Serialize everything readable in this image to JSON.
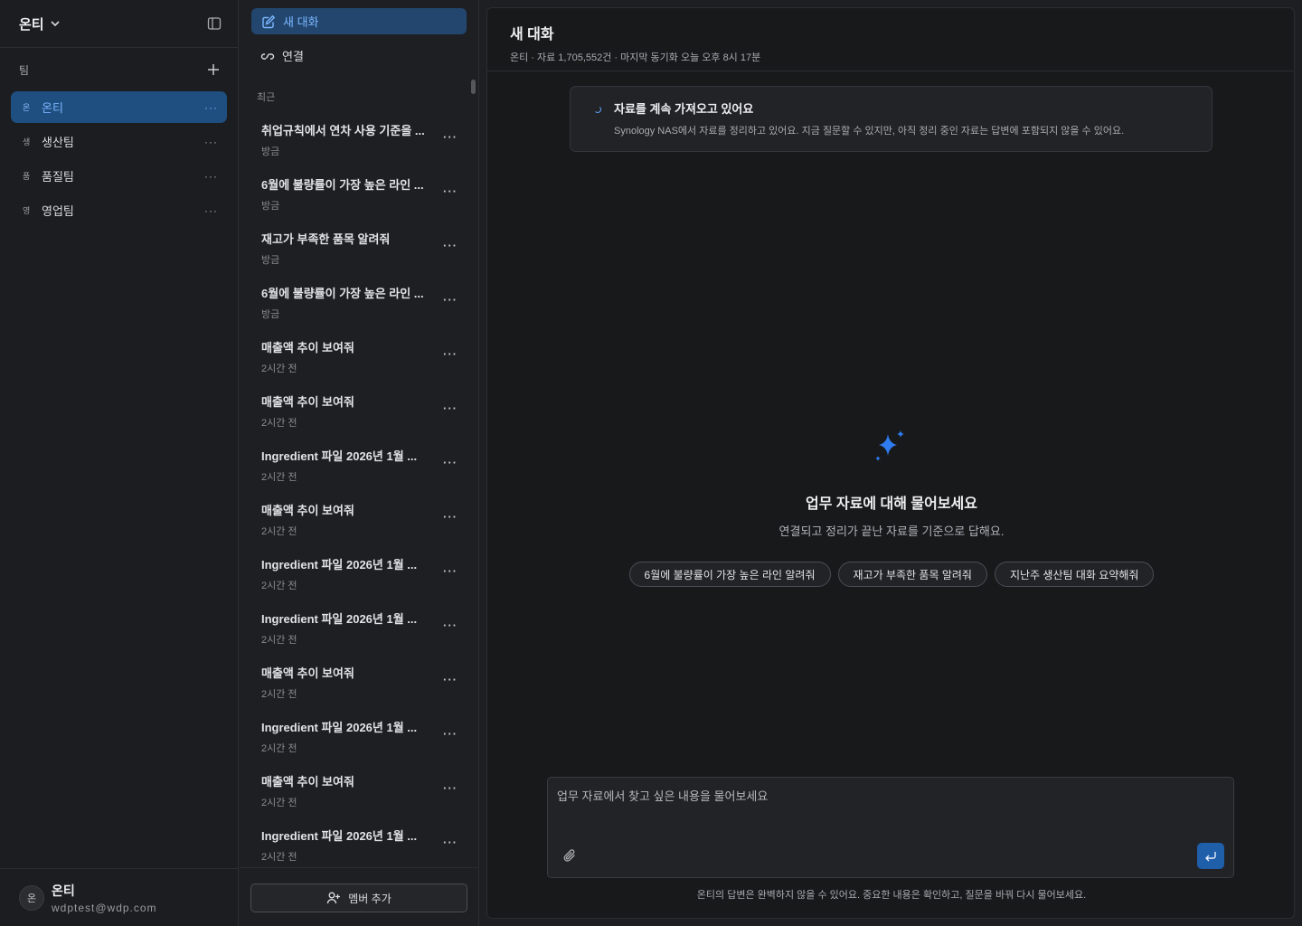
{
  "workspace": {
    "name": "온티"
  },
  "teams": {
    "label": "팀",
    "items": [
      {
        "abbr": "온",
        "name": "온티",
        "active": true
      },
      {
        "abbr": "생",
        "name": "생산팀",
        "active": false
      },
      {
        "abbr": "품",
        "name": "품질팀",
        "active": false
      },
      {
        "abbr": "영",
        "name": "영업팀",
        "active": false
      }
    ],
    "more": "···"
  },
  "user": {
    "avatar": "온",
    "name": "온티",
    "email": "wdptest@wdp.com"
  },
  "nav": {
    "new_chat": "새 대화",
    "connect": "연결",
    "recent": "최근"
  },
  "conversations": [
    {
      "title": "취업규칙에서 연차 사용 기준을 ...",
      "time": "방금"
    },
    {
      "title": "6월에 불량률이 가장 높은 라인 ...",
      "time": "방금"
    },
    {
      "title": "재고가 부족한 품목 알려줘",
      "time": "방금"
    },
    {
      "title": "6월에 불량률이 가장 높은 라인 ...",
      "time": "방금"
    },
    {
      "title": "매출액 추이 보여줘",
      "time": "2시간 전"
    },
    {
      "title": "매출액 추이 보여줘",
      "time": "2시간 전"
    },
    {
      "title": "Ingredient 파일 2026년 1월 ...",
      "time": "2시간 전"
    },
    {
      "title": "매출액 추이 보여줘",
      "time": "2시간 전"
    },
    {
      "title": "Ingredient 파일 2026년 1월 ...",
      "time": "2시간 전"
    },
    {
      "title": "Ingredient 파일 2026년 1월 ...",
      "time": "2시간 전"
    },
    {
      "title": "매출액 추이 보여줘",
      "time": "2시간 전"
    },
    {
      "title": "Ingredient 파일 2026년 1월 ...",
      "time": "2시간 전"
    },
    {
      "title": "매출액 추이 보여줘",
      "time": "2시간 전"
    },
    {
      "title": "Ingredient 파일 2026년 1월 ...",
      "time": "2시간 전"
    }
  ],
  "conv_more": "···",
  "add_member": "멤버 추가",
  "main": {
    "title": "새 대화",
    "subtitle": "온티 · 자료 1,705,552건 · 마지막 동기화 오늘 오후 8시 17분",
    "notice_title": "자료를 계속 가져오고 있어요",
    "notice_text": "Synology NAS에서 자료를 정리하고 있어요. 지금 질문할 수 있지만, 아직 정리 중인 자료는 답변에 포함되지 않을 수 있어요.",
    "empty_title": "업무 자료에 대해 물어보세요",
    "empty_sub": "연결되고 정리가 끝난 자료를 기준으로 답해요.",
    "suggestions": [
      "6월에 불량률이 가장 높은 라인 알려줘",
      "재고가 부족한 품목 알려줘",
      "지난주 생산팀 대화 요약해줘"
    ],
    "composer_placeholder": "업무 자료에서 찾고 싶은 내용을 물어보세요",
    "disclaimer": "온티의 답변은 완벽하지 않을 수 있어요. 중요한 내용은 확인하고, 질문을 바꿔 다시 물어보세요."
  },
  "colors": {
    "accent": "#1f5ea8",
    "active_bg": "#1f4f80",
    "active_text": "#7cb6ff"
  }
}
